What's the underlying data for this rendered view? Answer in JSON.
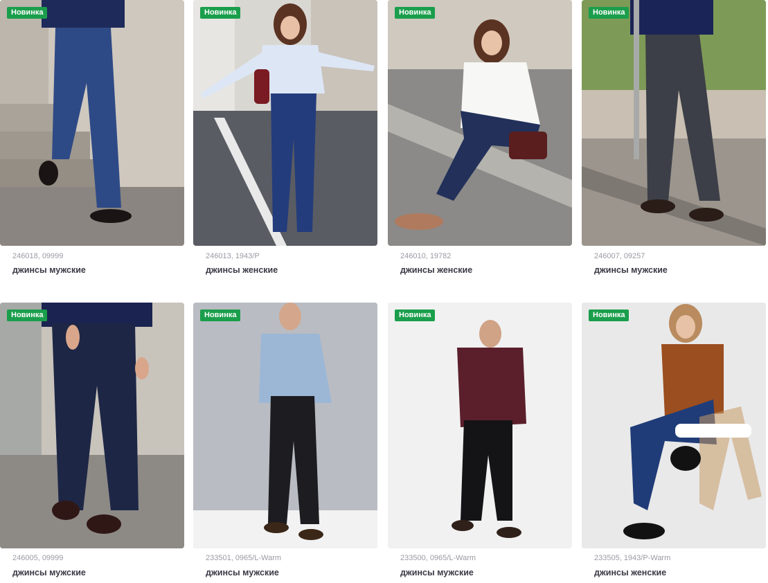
{
  "colors": {
    "badge_bg": "#1a9e4b",
    "text_dark": "#3a3a46",
    "text_muted": "#9a9aa3"
  },
  "products": [
    {
      "badge": "Новинка",
      "sku": "246018, 09999",
      "name": "джинсы мужские"
    },
    {
      "badge": "Новинка",
      "sku": "246013, 1943/P",
      "name": "джинсы женские"
    },
    {
      "badge": "Новинка",
      "sku": "246010, 19782",
      "name": "джинсы женские"
    },
    {
      "badge": "Новинка",
      "sku": "246007, 09257",
      "name": "джинсы мужские"
    },
    {
      "badge": "Новинка",
      "sku": "246005, 09999",
      "name": "джинсы мужские"
    },
    {
      "badge": "Новинка",
      "sku": "233501, 0965/L-Warm",
      "name": "джинсы мужские"
    },
    {
      "badge": "Новинка",
      "sku": "233500, 0965/L-Warm",
      "name": "джинсы мужские"
    },
    {
      "badge": "Новинка",
      "sku": "233505, 1943/P-Warm",
      "name": "джинсы женские"
    }
  ]
}
